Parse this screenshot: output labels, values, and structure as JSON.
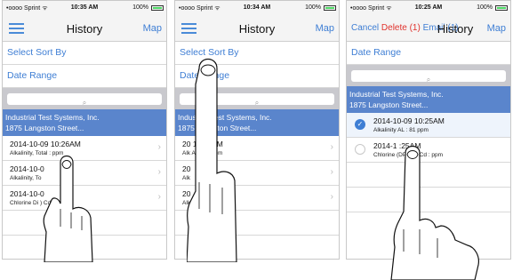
{
  "screens": [
    {
      "status": {
        "carrier": "•oooo Sprint ᯤ",
        "time": "10:35 AM",
        "battery": "100%"
      },
      "nav": {
        "title": "History",
        "map": "Map"
      },
      "actions": {
        "select": "Select",
        "sort": "Sort By"
      },
      "date_range": "Date Range",
      "search_icon": "⌕",
      "group": {
        "line1": "Industrial Test Systems, Inc.",
        "line2": "1875 Langston Street..."
      },
      "items": [
        {
          "title": "2014-10-09 10:26AM",
          "subtitle": "Alkalinity, Total :  ppm"
        },
        {
          "title": "2014-10-0",
          "subtitle": "Alkalinity, To"
        },
        {
          "title": "2014-10-0",
          "subtitle": "Chlorine Di          ) Cd :  ppm"
        }
      ]
    },
    {
      "status": {
        "carrier": "•oooo Sprint ᯤ",
        "time": "10:34 AM",
        "battery": "100%"
      },
      "nav": {
        "title": "History",
        "map": "Map"
      },
      "actions": {
        "select": "Select",
        "sort": "Sort By"
      },
      "date_range": "Date Range",
      "search_icon": "⌕",
      "group": {
        "line1": "Industrial Test Systems, Inc.",
        "line2": "1875 Langston Street..."
      },
      "items": [
        {
          "title": "20     10:26AM",
          "subtitle": "Alk         AL : 81 ppm"
        },
        {
          "title": "20",
          "subtitle": "Alk"
        },
        {
          "title": "20",
          "subtitle": "Alk"
        }
      ]
    },
    {
      "status": {
        "carrier": "•oooo Sprint ᯤ",
        "time": "10:25 AM",
        "battery": "100%"
      },
      "nav": {
        "title": "History",
        "map": "Map"
      },
      "actions": {
        "cancel": "Cancel",
        "delete": "Delete (1)",
        "email": "Email (1)"
      },
      "date_range": "Date Range",
      "search_icon": "⌕",
      "group": {
        "line1": "Industrial Test Systems, Inc.",
        "line2": "1875 Langston Street..."
      },
      "items": [
        {
          "title": "2014-10-09 10:25AM",
          "subtitle": "Alkalinity       AL : 81 ppm",
          "checked": true
        },
        {
          "title": "2014-1        :25AM",
          "subtitle": "Chlorine          (DPD-1) Cd :  ppm",
          "checked": false
        }
      ]
    }
  ]
}
